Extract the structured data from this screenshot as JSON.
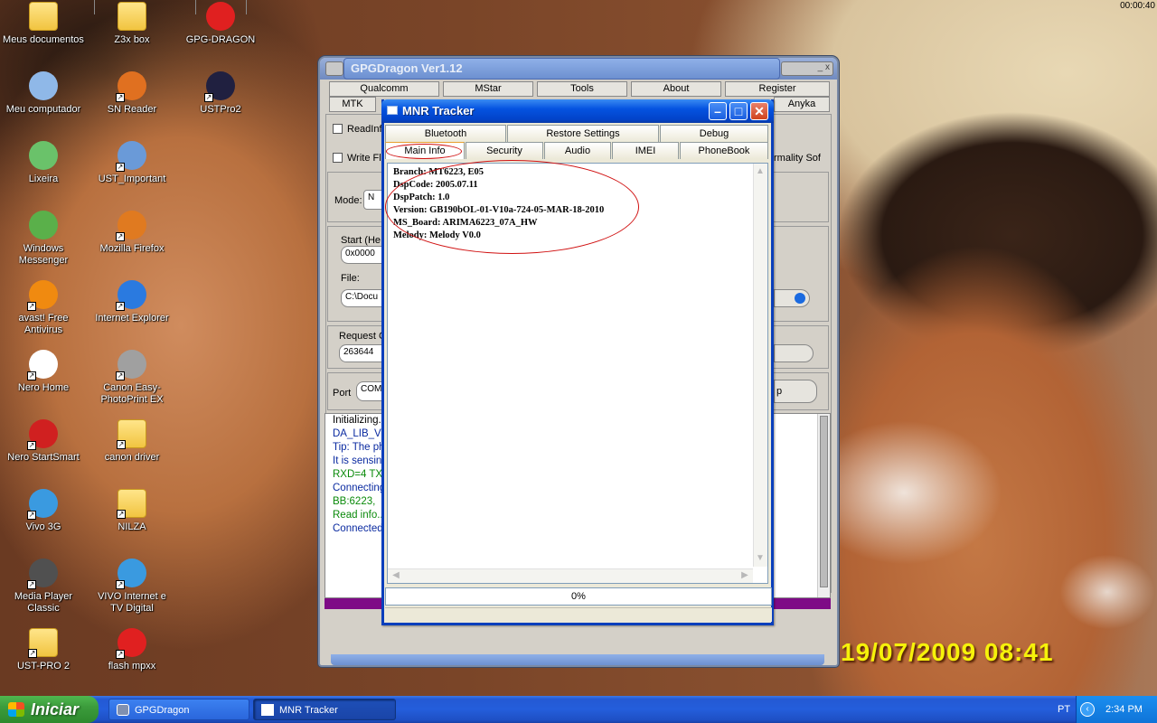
{
  "desktop": {
    "icons": [
      {
        "label": "Meus documentos",
        "icon": "my-documents-icon",
        "color": "#f3d56a"
      },
      {
        "label": "Z3x box",
        "icon": "folder-icon",
        "color": "#f3d56a"
      },
      {
        "label": "GPG-DRAGON",
        "icon": "no-entry-icon",
        "color": "#e02020"
      },
      {
        "label": "Meu computador",
        "icon": "my-computer-icon",
        "color": "#8fb8e8"
      },
      {
        "label": "SN Reader",
        "icon": "butterfly-icon",
        "color": "#e07020"
      },
      {
        "label": "USTPro2",
        "icon": "ust-icon",
        "color": "#202040"
      },
      {
        "label": "Lixeira",
        "icon": "recycle-bin-icon",
        "color": "#6ac26a"
      },
      {
        "label": "UST_Important",
        "icon": "search-document-icon",
        "color": "#6a9ad8"
      },
      {
        "label": "Windows Messenger",
        "icon": "messenger-icon",
        "color": "#5ab04a"
      },
      {
        "label": "Mozilla Firefox",
        "icon": "firefox-icon",
        "color": "#e07a20"
      },
      {
        "label": "avast! Free Antivirus",
        "icon": "avast-icon",
        "color": "#f08a10"
      },
      {
        "label": "Internet Explorer",
        "icon": "internet-explorer-icon",
        "color": "#2a7ae0"
      },
      {
        "label": "Nero Home",
        "icon": "nero-home-icon",
        "color": "#ffffff"
      },
      {
        "label": "Canon Easy-PhotoPrint EX",
        "icon": "printer-icon",
        "color": "#a0a0a0"
      },
      {
        "label": "Nero StartSmart",
        "icon": "nero-startsmart-icon",
        "color": "#d02020"
      },
      {
        "label": "canon driver",
        "icon": "folder-icon",
        "color": "#f3d56a"
      },
      {
        "label": "Vivo 3G",
        "icon": "vivo-icon",
        "color": "#3a9ae0"
      },
      {
        "label": "NILZA",
        "icon": "folder-icon",
        "color": "#f3d56a"
      },
      {
        "label": "Media Player Classic",
        "icon": "media-player-icon",
        "color": "#505050"
      },
      {
        "label": "VIVO Internet e TV Digital",
        "icon": "vivo-icon",
        "color": "#3a9ae0"
      },
      {
        "label": "UST-PRO 2",
        "icon": "folder-icon",
        "color": "#f3d56a"
      },
      {
        "label": "flash mpxx",
        "icon": "power-icon",
        "color": "#e02020"
      }
    ],
    "photo_date": "19/07/2009 08:41"
  },
  "gpg": {
    "title": "GPGDragon Ver1.12",
    "close_btn": "_ x",
    "tabs_row1": [
      "Qualcomm",
      "MStar",
      "Tools",
      "About",
      "Register"
    ],
    "tabs_row2_left": "MTK",
    "tabs_row2_right": "Anyka",
    "read_label": "ReadInf",
    "write_label": "Write Fl",
    "normality_label": "rmality Sof",
    "mode_label": "Mode:",
    "mode_value": "N",
    "start_label": "Start (He",
    "start_value": "0x0000",
    "file_label": "File:",
    "file_value": "C:\\Docu",
    "request_label": "Request C",
    "request_value": "263644",
    "port_label": "Port",
    "port_value": "COM",
    "port_btn": "p",
    "log": [
      {
        "text": "Initializing...",
        "color": "#000000"
      },
      {
        "text": "DA_LIB_VE",
        "color": "#0a2aa0"
      },
      {
        "text": "Tip: The ph",
        "color": "#0a2aa0"
      },
      {
        "text": "It is sensin",
        "color": "#0a2aa0"
      },
      {
        "text": "RXD=4  TX",
        "color": "#0a8a0a"
      },
      {
        "text": "Connecting",
        "color": "#0a2aa0"
      },
      {
        "text": "BB:6223,",
        "color": "#0a8a0a"
      },
      {
        "text": "Read info...",
        "color": "#0a8a0a"
      },
      {
        "text": "Connected",
        "color": "#0a2aa0"
      }
    ],
    "timer": "00:00:40"
  },
  "mnr": {
    "title": "MNR Tracker",
    "tabs_row1": [
      "Bluetooth",
      "Restore Settings",
      "Debug"
    ],
    "tabs_row2": [
      "Main Info",
      "Security",
      "Audio",
      "IMEI",
      "PhoneBook"
    ],
    "info_lines": [
      "Branch:  MT6223, E05",
      "DspCode:  2005.07.11",
      "DspPatch: 1.0",
      "Version:  GB190bOL-01-V10a-724-05-MAR-18-2010",
      "MS_Board: ARIMA6223_07A_HW",
      "Melody:   Melody V0.0"
    ],
    "progress": "0%",
    "progress_value": 0
  },
  "taskbar": {
    "start": "Iniciar",
    "items": [
      {
        "label": "GPGDragon"
      },
      {
        "label": "MNR Tracker"
      }
    ],
    "lang": "PT",
    "clock": "2:34 PM"
  },
  "colors": {
    "annotation": "#d01010",
    "xp_blue": "#0553e0",
    "start_green": "#3c9c3c"
  }
}
